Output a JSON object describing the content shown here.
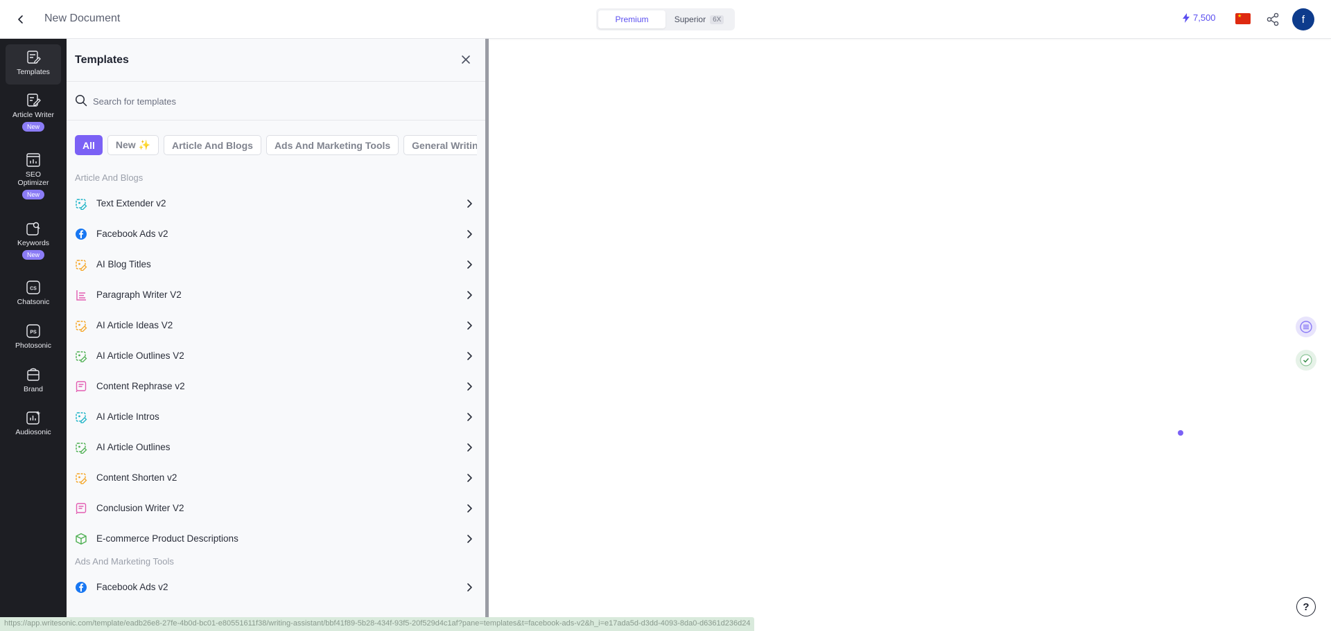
{
  "header": {
    "title": "New Document",
    "plans": [
      {
        "label": "Premium"
      },
      {
        "label": "Superior",
        "badge": "6X"
      }
    ],
    "credits": "7,500"
  },
  "user": {
    "initial": "f"
  },
  "sidebar": {
    "items": [
      {
        "label": "Templates"
      },
      {
        "label": "Article Writer",
        "badge": "New"
      },
      {
        "label": "SEO Optimizer",
        "badge": "New"
      },
      {
        "label": "Keywords",
        "badge": "New"
      },
      {
        "label": "Chatsonic"
      },
      {
        "label": "Photosonic"
      },
      {
        "label": "Brand"
      },
      {
        "label": "Audiosonic"
      }
    ]
  },
  "panel": {
    "title": "Templates",
    "search_placeholder": "Search for templates",
    "chips": [
      "All",
      "New ✨",
      "Article And Blogs",
      "Ads And Marketing Tools",
      "General Writin"
    ],
    "sections": [
      {
        "title": "Article And Blogs",
        "items": [
          {
            "label": "Text Extender v2",
            "icon": "text-extender-icon",
            "color": "#1ab3c6"
          },
          {
            "label": "Facebook Ads v2",
            "icon": "facebook-icon",
            "color": "#1877f2"
          },
          {
            "label": "AI Blog Titles",
            "icon": "blog-titles-icon",
            "color": "#f5a524"
          },
          {
            "label": "Paragraph Writer V2",
            "icon": "paragraph-icon",
            "color": "#e25db2"
          },
          {
            "label": "AI Article Ideas V2",
            "icon": "article-ideas-icon",
            "color": "#f5a524"
          },
          {
            "label": "AI Article Outlines V2",
            "icon": "article-outlines-icon",
            "color": "#4caf50"
          },
          {
            "label": "Content Rephrase v2",
            "icon": "rephrase-icon",
            "color": "#e25db2"
          },
          {
            "label": "AI Article Intros",
            "icon": "article-intros-icon",
            "color": "#1ab3c6"
          },
          {
            "label": "AI Article Outlines",
            "icon": "article-outlines-icon",
            "color": "#4caf50"
          },
          {
            "label": "Content Shorten v2",
            "icon": "shorten-icon",
            "color": "#f5a524"
          },
          {
            "label": "Conclusion Writer V2",
            "icon": "conclusion-icon",
            "color": "#e25db2"
          },
          {
            "label": "E-commerce Product Descriptions",
            "icon": "product-box-icon",
            "color": "#4caf50"
          }
        ]
      },
      {
        "title": "Ads And Marketing Tools",
        "items": [
          {
            "label": "Facebook Ads v2",
            "icon": "facebook-icon",
            "color": "#1877f2"
          }
        ]
      }
    ]
  },
  "status_url": "https://app.writesonic.com/template/eadb26e8-27fe-4b0d-bc01-e80551611f38/writing-assistant/bbf41f89-5b28-434f-93f5-20f529d4c1af?pane=templates&t=facebook-ads-v2&h_i=e17ada5d-d3dd-4093-8da0-d6361d236d24",
  "colors": {
    "accent": "#7b61f5",
    "sidebar_bg": "#1d1e23",
    "avatar": "#0d3b8c"
  }
}
